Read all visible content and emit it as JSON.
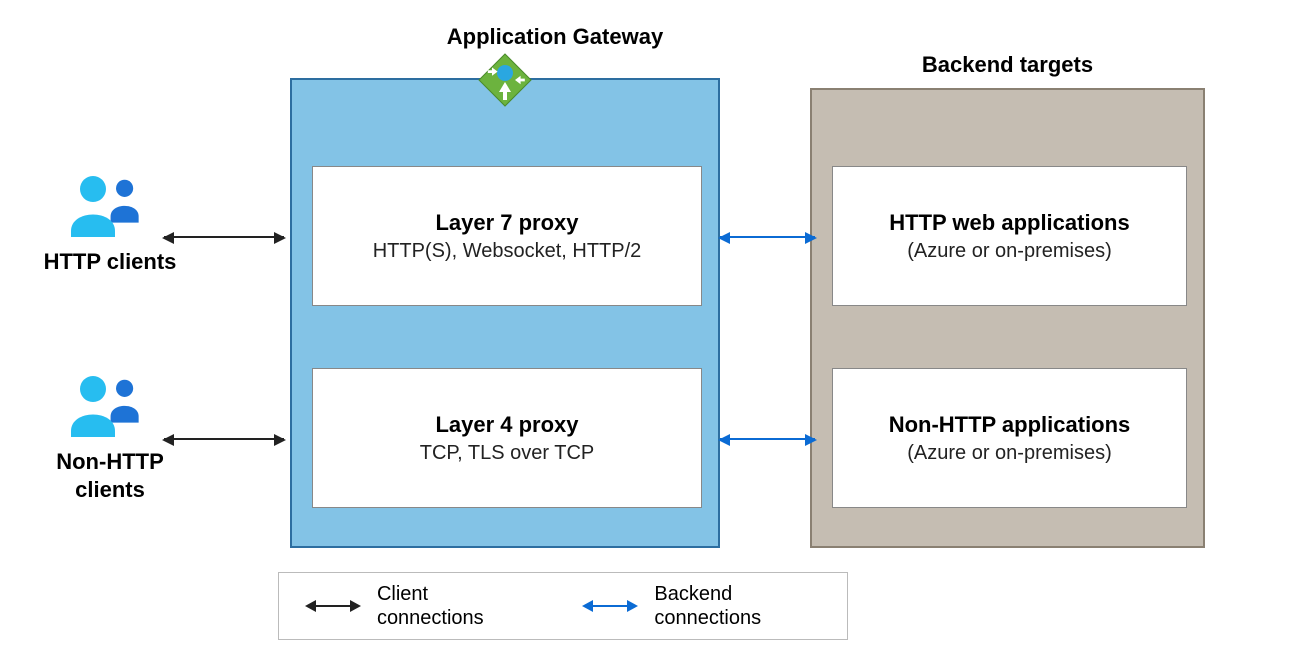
{
  "titles": {
    "gateway": "Application Gateway",
    "backend": "Backend targets"
  },
  "clients": {
    "http": "HTTP clients",
    "nonhttp": "Non-HTTP clients"
  },
  "proxies": {
    "l7": {
      "title": "Layer 7 proxy",
      "sub": "HTTP(S), Websocket, HTTP/2"
    },
    "l4": {
      "title": "Layer 4 proxy",
      "sub": "TCP, TLS over TCP"
    }
  },
  "backends": {
    "http": {
      "title": "HTTP web applications",
      "sub": "(Azure or on-premises)"
    },
    "nonhttp": {
      "title": "Non-HTTP applications",
      "sub": "(Azure or on-premises)"
    }
  },
  "legend": {
    "client": "Client connections",
    "backend": "Backend connections"
  },
  "colors": {
    "gateway_fill": "#83c3e6",
    "gateway_border": "#2d6ea0",
    "backend_fill": "#c5bdb2",
    "backend_border": "#8a8072",
    "client_arrow": "#222222",
    "backend_arrow": "#0b6bd4"
  }
}
